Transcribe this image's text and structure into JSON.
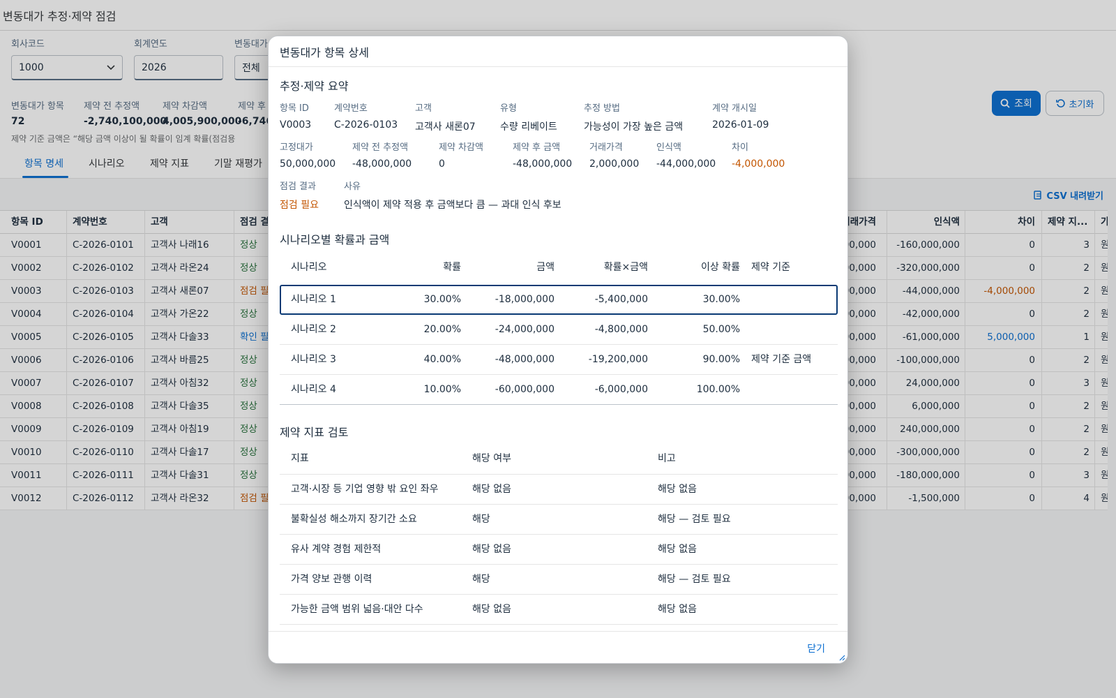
{
  "app": {
    "title": "변동대가 추정·제약 점검"
  },
  "filters": {
    "company": {
      "label": "회사코드",
      "value": "1000"
    },
    "year": {
      "label": "회계연도",
      "value": "2026"
    },
    "type": {
      "label": "변동대가",
      "value": "전체"
    },
    "search_label": "조회",
    "reset_label": "초기화"
  },
  "kpis": [
    {
      "label": "변동대가 항목",
      "value": "72"
    },
    {
      "label": "제약 전 추정액",
      "value": "-2,740,100,000"
    },
    {
      "label": "제약 차감액",
      "value": "4,005,900,000"
    },
    {
      "label": "제약 후",
      "value": "-6,746,"
    }
  ],
  "note": "제약 기준 금액은 “해당 금액 이상이 될 확률이 임계 확률(점검용",
  "tabs": [
    "항목 명세",
    "시나리오",
    "제약 지표",
    "기말 재평가"
  ],
  "csv_label": "CSV 내려받기",
  "grid": {
    "headers_left": [
      "항목 ID",
      "계약번호",
      "고객",
      "점검 결"
    ],
    "headers_right": [
      "거래가격",
      "인식액",
      "차이",
      "제약 지...",
      "가"
    ],
    "rows": [
      {
        "id": "V0001",
        "contract": "C-2026-0101",
        "customer": "고객사 나래16",
        "status": "정상",
        "st": "ok",
        "price": "000,000",
        "recog": "-160,000,000",
        "diff": "0",
        "dst": "",
        "cnt": "3",
        "tail": "원"
      },
      {
        "id": "V0002",
        "contract": "C-2026-0102",
        "customer": "고객사 라온24",
        "status": "정상",
        "st": "ok",
        "price": "000,000",
        "recog": "-320,000,000",
        "diff": "0",
        "dst": "",
        "cnt": "2",
        "tail": "원"
      },
      {
        "id": "V0003",
        "contract": "C-2026-0103",
        "customer": "고객사 새론07",
        "status": "점검 필",
        "st": "warn",
        "price": "000,000",
        "recog": "-44,000,000",
        "diff": "-4,000,000",
        "dst": "warn",
        "cnt": "2",
        "tail": "원"
      },
      {
        "id": "V0004",
        "contract": "C-2026-0104",
        "customer": "고객사 가온22",
        "status": "정상",
        "st": "ok",
        "price": "000,000",
        "recog": "-42,000,000",
        "diff": "0",
        "dst": "",
        "cnt": "2",
        "tail": "원"
      },
      {
        "id": "V0005",
        "contract": "C-2026-0105",
        "customer": "고객사 다솔33",
        "status": "확인 필",
        "st": "info",
        "price": "000,000",
        "recog": "-61,000,000",
        "diff": "5,000,000",
        "dst": "info",
        "cnt": "1",
        "tail": "원"
      },
      {
        "id": "V0006",
        "contract": "C-2026-0106",
        "customer": "고객사 바름25",
        "status": "정상",
        "st": "ok",
        "price": "000,000",
        "recog": "-100,000,000",
        "diff": "0",
        "dst": "",
        "cnt": "2",
        "tail": "원"
      },
      {
        "id": "V0007",
        "contract": "C-2026-0107",
        "customer": "고객사 아침32",
        "status": "정상",
        "st": "ok",
        "price": "000,000",
        "recog": "24,000,000",
        "diff": "0",
        "dst": "",
        "cnt": "3",
        "tail": "원"
      },
      {
        "id": "V0008",
        "contract": "C-2026-0108",
        "customer": "고객사 다솔35",
        "status": "정상",
        "st": "ok",
        "price": "000,000",
        "recog": "6,000,000",
        "diff": "0",
        "dst": "",
        "cnt": "2",
        "tail": "원"
      },
      {
        "id": "V0009",
        "contract": "C-2026-0109",
        "customer": "고객사 아침19",
        "status": "정상",
        "st": "ok",
        "price": "000,000",
        "recog": "240,000,000",
        "diff": "0",
        "dst": "",
        "cnt": "2",
        "tail": "원"
      },
      {
        "id": "V0010",
        "contract": "C-2026-0110",
        "customer": "고객사 다솔17",
        "status": "정상",
        "st": "ok",
        "price": "000,000",
        "recog": "-300,000,000",
        "diff": "0",
        "dst": "",
        "cnt": "2",
        "tail": "원"
      },
      {
        "id": "V0011",
        "contract": "C-2026-0111",
        "customer": "고객사 다솔31",
        "status": "정상",
        "st": "ok",
        "price": "000,000",
        "recog": "-180,000,000",
        "diff": "0",
        "dst": "",
        "cnt": "3",
        "tail": "원"
      },
      {
        "id": "V0012",
        "contract": "C-2026-0112",
        "customer": "고객사 라온32",
        "status": "점검 필",
        "st": "warn",
        "price": "500,000",
        "recog": "-1,500,000",
        "diff": "0",
        "dst": "",
        "cnt": "4",
        "tail": "원"
      }
    ]
  },
  "dialog": {
    "title": "변동대가 항목 상세",
    "summary_title": "추정·제약 요약",
    "row1": [
      {
        "label": "항목 ID",
        "value": "V0003"
      },
      {
        "label": "계약번호",
        "value": "C-2026-0103"
      },
      {
        "label": "고객",
        "value": "고객사 새론07"
      },
      {
        "label": "유형",
        "value": "수량 리베이트"
      },
      {
        "label": "추정 방법",
        "value": "가능성이 가장 높은 금액"
      },
      {
        "label": "계약 개시일",
        "value": "2026-01-09"
      }
    ],
    "row2": [
      {
        "label": "고정대가",
        "value": "50,000,000"
      },
      {
        "label": "제약 전 추정액",
        "value": "-48,000,000"
      },
      {
        "label": "제약 차감액",
        "value": "0"
      },
      {
        "label": "제약 후 금액",
        "value": "-48,000,000"
      },
      {
        "label": "거래가격",
        "value": "2,000,000"
      },
      {
        "label": "인식액",
        "value": "-44,000,000"
      },
      {
        "label": "차이",
        "value": "-4,000,000"
      }
    ],
    "row3": [
      {
        "label": "점검 결과",
        "value": "점검 필요"
      },
      {
        "label": "사유",
        "value": "인식액이 제약 적용 후 금액보다 큼 — 과대 인식 후보"
      }
    ],
    "scen_title": "시나리오별 확률과 금액",
    "scen_headers": [
      "시나리오",
      "확률",
      "금액",
      "확률×금액",
      "이상 확률",
      "제약 기준"
    ],
    "scenarios": [
      {
        "name": "시나리오 1",
        "prob": "30.00%",
        "amt": "-18,000,000",
        "pxa": "-5,400,000",
        "cum": "30.00%",
        "base": ""
      },
      {
        "name": "시나리오 2",
        "prob": "20.00%",
        "amt": "-24,000,000",
        "pxa": "-4,800,000",
        "cum": "50.00%",
        "base": ""
      },
      {
        "name": "시나리오 3",
        "prob": "40.00%",
        "amt": "-48,000,000",
        "pxa": "-19,200,000",
        "cum": "90.00%",
        "base": "제약 기준 금액"
      },
      {
        "name": "시나리오 4",
        "prob": "10.00%",
        "amt": "-60,000,000",
        "pxa": "-6,000,000",
        "cum": "100.00%",
        "base": ""
      }
    ],
    "ind_title": "제약 지표 검토",
    "ind_headers": [
      "지표",
      "해당 여부",
      "비고"
    ],
    "indicators": [
      {
        "name": "고객·시장 등 기업 영향 밖 요인 좌우",
        "applies": "해당 없음",
        "remark": "해당 없음"
      },
      {
        "name": "불확실성 해소까지 장기간 소요",
        "applies": "해당",
        "remark": "해당 — 검토 필요"
      },
      {
        "name": "유사 계약 경험 제한적",
        "applies": "해당 없음",
        "remark": "해당 없음"
      },
      {
        "name": "가격 양보 관행 이력",
        "applies": "해당",
        "remark": "해당 — 검토 필요"
      },
      {
        "name": "가능한 금액 범위 넓음·대안 다수",
        "applies": "해당 없음",
        "remark": "해당 없음"
      }
    ],
    "close_label": "닫기"
  }
}
